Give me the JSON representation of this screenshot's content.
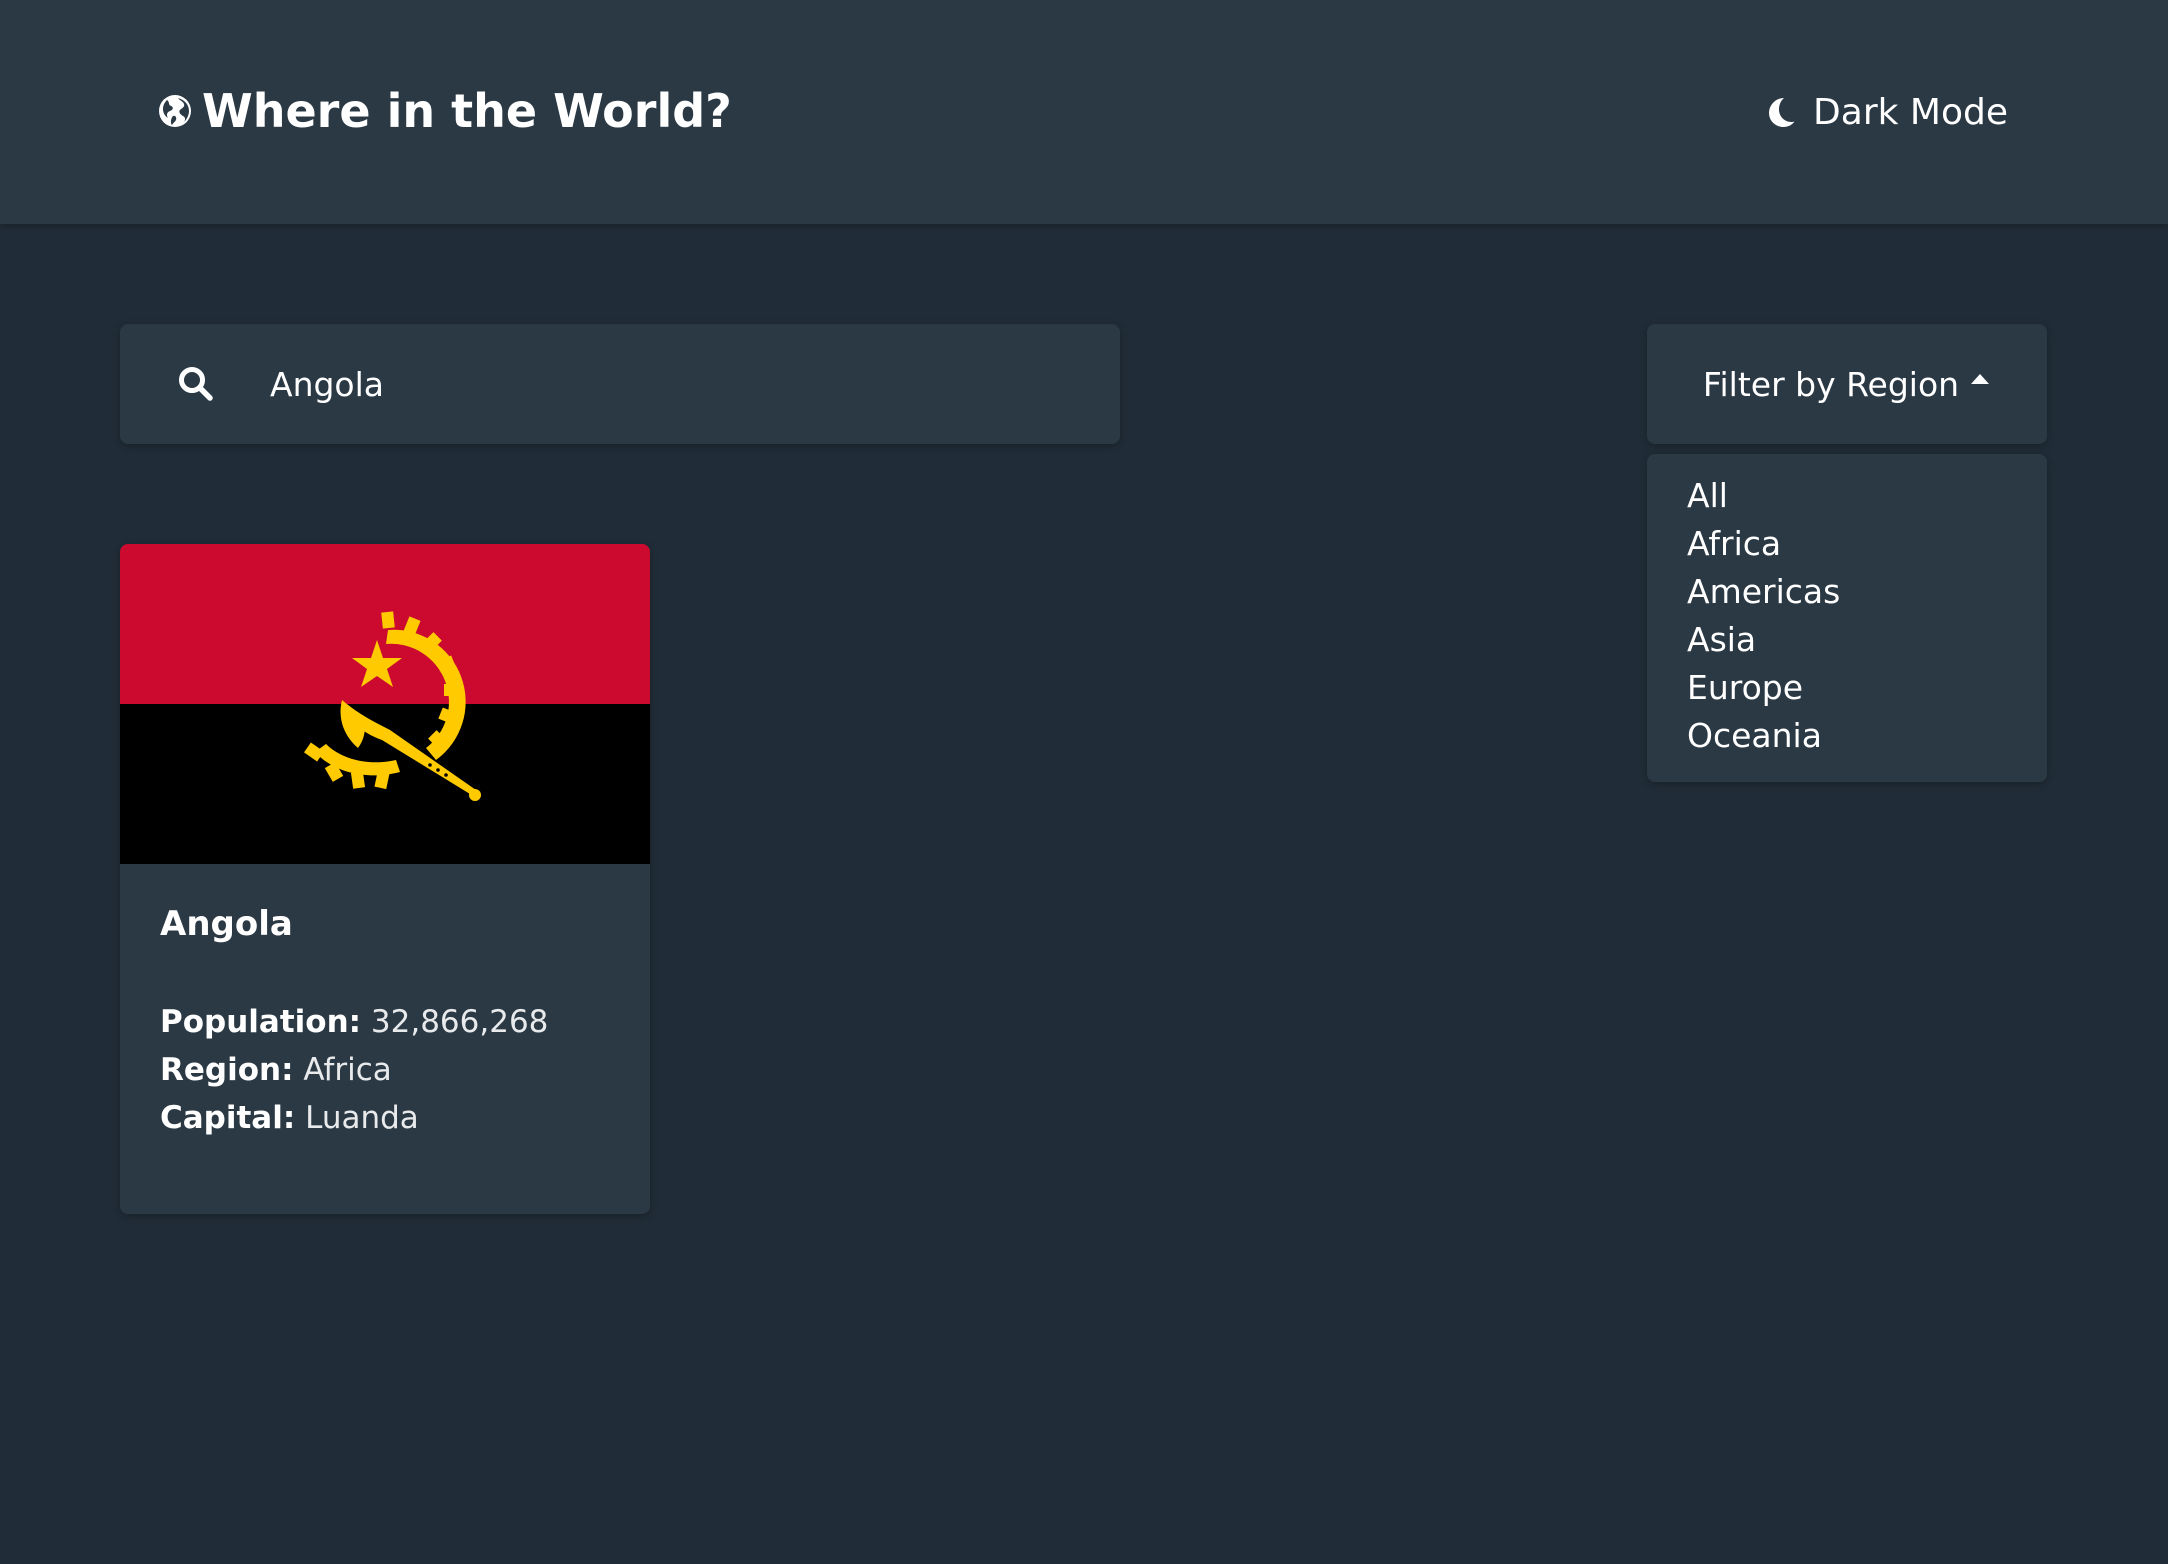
{
  "header": {
    "title": "Where in the World?",
    "theme_toggle_label": "Dark Mode"
  },
  "search": {
    "value": "Angola"
  },
  "filter": {
    "label": "Filter by Region",
    "options": [
      "All",
      "Africa",
      "Americas",
      "Asia",
      "Europe",
      "Oceania"
    ]
  },
  "countries": [
    {
      "name": "Angola",
      "population_label": "Population:",
      "population": "32,866,268",
      "region_label": "Region:",
      "region": "Africa",
      "capital_label": "Capital:",
      "capital": "Luanda"
    }
  ],
  "colors": {
    "background": "#202c37",
    "elements": "#2b3945",
    "text": "#ffffff",
    "flag_red": "#cc092f",
    "flag_black": "#000000",
    "flag_emblem": "#ffcb00"
  },
  "icons": {
    "brand": "globe-icon",
    "theme": "moon-icon",
    "search": "search-icon",
    "filter": "caret-up-icon"
  }
}
